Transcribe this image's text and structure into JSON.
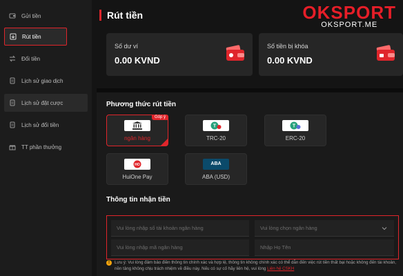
{
  "sidebar": {
    "items": [
      {
        "label": "Gửi tiền",
        "icon": "wallet-icon"
      },
      {
        "label": "Rút tiền",
        "icon": "withdraw-icon"
      },
      {
        "label": "Đổi tiền",
        "icon": "exchange-icon"
      },
      {
        "label": "Lịch sử giao dịch",
        "icon": "transaction-history-icon"
      },
      {
        "label": "Lịch sử đặt cược",
        "icon": "bet-history-icon"
      },
      {
        "label": "Lịch sử đổi tiền",
        "icon": "exchange-history-icon"
      },
      {
        "label": "TT phần thưởng",
        "icon": "reward-icon"
      }
    ]
  },
  "header": {
    "title": "Rút tiền",
    "brand_main": "OKSPORT",
    "brand_sub": "OKSPORT.ME"
  },
  "balances": {
    "wallet_label": "Số dư ví",
    "wallet_value": "0.00 KVND",
    "locked_label": "Số tiền bị khóa",
    "locked_value": "0.00 KVND"
  },
  "methods": {
    "title": "Phương thức rút tiền",
    "badge": "Góp ý",
    "items": [
      {
        "label": "ngân hàng",
        "icon": "bank-icon"
      },
      {
        "label": "TRC-20",
        "icon": "tether-trc20-icon"
      },
      {
        "label": "ERC-20",
        "icon": "tether-erc20-icon"
      },
      {
        "label": "HuiOne Pay",
        "icon": "huione-icon",
        "icon_text": "HO"
      },
      {
        "label": "ABA (USD)",
        "icon": "aba-icon",
        "icon_text": "ABA"
      }
    ]
  },
  "form": {
    "title": "Thông tin nhận tiền",
    "account_placeholder": "Vui lòng nhập số tài khoản ngân hàng",
    "bank_placeholder": "Vui lòng chọn ngân hàng",
    "bank_name_placeholder": "Vui lòng nhập mã ngân hàng",
    "name_placeholder": "Nhập Họ Tên"
  },
  "note": {
    "text": "Lưu ý: Vui lòng đảm bảo điền thông tin chính xác và hợp lệ, thông tin không chính xác có thể dẫn đến việc rút tiền thất bại hoặc không đến tài khoản, nền tảng không chịu trách nhiệm về điều này. Nếu có sự cố hãy liên hệ, vui lòng",
    "link": "Liên hệ CSKH"
  },
  "colors": {
    "accent": "#e0252b",
    "background": "#141414",
    "card": "#262626"
  }
}
